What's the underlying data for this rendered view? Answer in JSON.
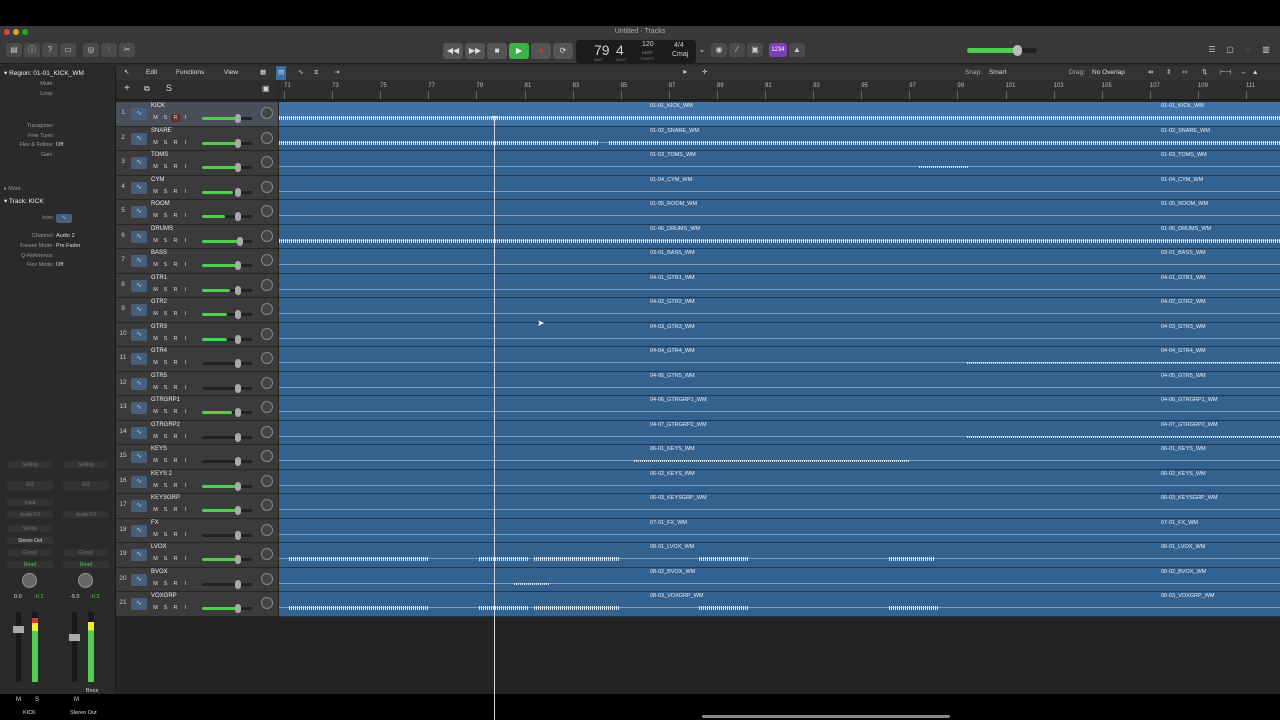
{
  "window": {
    "title": "Untitled - Tracks"
  },
  "transport": {
    "bar": "79",
    "beat": "4",
    "bar_label": "BAR",
    "beat_label": "BEAT",
    "tempo": "120",
    "tempo_sub": "KEEP",
    "tempo_label": "TEMPO",
    "sig": "4/4",
    "key": "Cmaj",
    "lcd_mode": "1234"
  },
  "localbar": {
    "edit": "Edit",
    "functions": "Functions",
    "view": "View",
    "snap_label": "Snap:",
    "snap_value": "Smart",
    "drag_label": "Drag:",
    "drag_value": "No Overlap"
  },
  "inspector": {
    "region_header": "Region: 01-01_KICK_WM",
    "region_rows": [
      {
        "k": "Mute:",
        "v": ""
      },
      {
        "k": "Loop:",
        "v": ""
      },
      {
        "k": "Transpose:",
        "v": ""
      },
      {
        "k": "Fine Tune:",
        "v": ""
      },
      {
        "k": "Flex & Follow:",
        "v": "Off"
      },
      {
        "k": "Gain:",
        "v": ""
      }
    ],
    "more": "More",
    "track_header": "Track:  KICK",
    "track_rows": [
      {
        "k": "Icon:",
        "v": ""
      },
      {
        "k": "Channel:",
        "v": "Audio 2"
      },
      {
        "k": "Freeze Mode:",
        "v": "Pre Fader"
      },
      {
        "k": "Q-Reference:",
        "v": ""
      },
      {
        "k": "Flex Mode:",
        "v": "Off"
      }
    ],
    "strip1": {
      "setting": "Setting",
      "eq": "EQ",
      "input": "Input",
      "audio_fx": "Audio FX",
      "sends": "Sends",
      "output": "Stereo Out",
      "group": "Group",
      "auto": "Read",
      "vol": "0.0",
      "peak": "-0.1",
      "name": "KICK",
      "m": "M",
      "s": "S"
    },
    "strip2": {
      "setting": "Setting",
      "eq": "EQ",
      "audio_fx": "Audio FX",
      "group": "Group",
      "auto": "Read",
      "vol": "-5.0",
      "peak": "-0.2",
      "name": "Stereo Out",
      "m": "M",
      "bnce": "Bnce"
    }
  },
  "ruler": {
    "marks": [
      "71",
      "73",
      "75",
      "77",
      "79",
      "81",
      "83",
      "85",
      "87",
      "89",
      "91",
      "93",
      "95",
      "97",
      "99",
      "101",
      "103",
      "105",
      "107",
      "109",
      "111"
    ]
  },
  "tracks": [
    {
      "num": "1",
      "name": "KICK",
      "region": "01-01_KICK_WM",
      "vol": 0.7,
      "wave": "dense"
    },
    {
      "num": "2",
      "name": "SNARE",
      "region": "01-02_SNARE_WM",
      "vol": 0.7,
      "wave": "dense"
    },
    {
      "num": "3",
      "name": "TOMS",
      "region": "01-03_TOMS_WM",
      "vol": 0.7,
      "wave": "thin"
    },
    {
      "num": "4",
      "name": "CYM",
      "region": "01-04_CYM_WM",
      "vol": 0.62,
      "wave": "thin"
    },
    {
      "num": "5",
      "name": "ROOM",
      "region": "01-05_ROOM_WM",
      "vol": 0.45,
      "wave": "thin"
    },
    {
      "num": "6",
      "name": "DRUMS",
      "region": "01-06_DRUMS_WM",
      "vol": 0.75,
      "wave": "dense"
    },
    {
      "num": "7",
      "name": "BASS",
      "region": "03-01_BASS_WM",
      "vol": 0.7,
      "wave": "thin"
    },
    {
      "num": "8",
      "name": "GTR1",
      "region": "04-01_GTR1_WM",
      "vol": 0.55,
      "wave": "thin"
    },
    {
      "num": "9",
      "name": "GTR2",
      "region": "04-02_GTR2_WM",
      "vol": 0.5,
      "wave": "thin"
    },
    {
      "num": "10",
      "name": "GTR3",
      "region": "04-03_GTR3_WM",
      "vol": 0.5,
      "wave": "thin"
    },
    {
      "num": "11",
      "name": "GTR4",
      "region": "04-04_GTR4_WM",
      "vol": 0.0,
      "wave": "thin"
    },
    {
      "num": "12",
      "name": "GTR5",
      "region": "04-05_GTR5_WM",
      "vol": 0.0,
      "wave": "thin"
    },
    {
      "num": "13",
      "name": "GTRGRP1",
      "region": "04-06_GTRGRP1_WM",
      "vol": 0.6,
      "wave": "thin"
    },
    {
      "num": "14",
      "name": "GTRGRP2",
      "region": "04-07_GTRGRP2_WM",
      "vol": 0.0,
      "wave": "thin"
    },
    {
      "num": "15",
      "name": "KEYS",
      "region": "06-01_KEYS_WM",
      "vol": 0.0,
      "wave": "thin"
    },
    {
      "num": "16",
      "name": "KEYS 2",
      "region": "06-02_KEYS_WM",
      "vol": 0.7,
      "wave": "thin"
    },
    {
      "num": "17",
      "name": "KEYSGRP",
      "region": "06-03_KEYSGRP_WM",
      "vol": 0.7,
      "wave": "thin"
    },
    {
      "num": "18",
      "name": "FX",
      "region": "07-01_FX_WM",
      "vol": 0.0,
      "wave": "thin"
    },
    {
      "num": "19",
      "name": "LVOX",
      "region": "08-01_LVOX_WM",
      "vol": 0.7,
      "wave": "dense"
    },
    {
      "num": "20",
      "name": "BVOX",
      "region": "08-02_BVOX_WM",
      "vol": 0.0,
      "wave": "thin"
    },
    {
      "num": "21",
      "name": "VOXGRP",
      "region": "08-03_VOXGRP_WM",
      "vol": 0.7,
      "wave": "dense"
    }
  ],
  "msri": [
    "M",
    "S",
    "R",
    "I"
  ],
  "colors": {
    "region": "#34628f",
    "region_sel": "#3f73a6",
    "meter": "#4fcf4f",
    "record": "#d33",
    "play": "#3bb34a",
    "accent": "#7b3fb8"
  }
}
